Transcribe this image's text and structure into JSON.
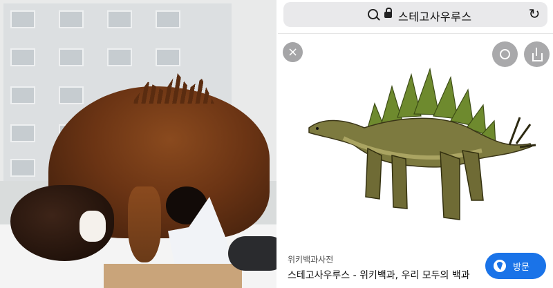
{
  "browser": {
    "address_text": "스테고사우루스",
    "icons": [
      "search-icon",
      "lock-icon",
      "reload-icon"
    ]
  },
  "viewer": {
    "close_icon": "×",
    "lens_icon": "lens-icon",
    "share_icon": "share-icon"
  },
  "result": {
    "source": "위키백과사전",
    "title": "스테고사우루스 - 위키백과, 우리 모두의 백과",
    "visit_label": "방문"
  }
}
